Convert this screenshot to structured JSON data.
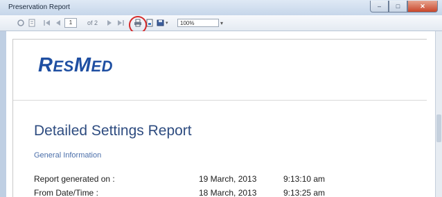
{
  "window": {
    "title": "Preservation Report",
    "buttons": {
      "minimize": "–",
      "maximize": "□",
      "close": "✕"
    }
  },
  "toolbar": {
    "page_current": "1",
    "page_of": "of 2",
    "zoom": "100%",
    "icons": [
      "refresh-icon",
      "print-layout-icon",
      "first-page-icon",
      "previous-page-icon",
      "next-page-icon",
      "last-page-icon",
      "print-icon",
      "page-setup-icon",
      "export-icon"
    ]
  },
  "report": {
    "logo_first": "R",
    "logo_rest": "ES",
    "logo_med_first": "M",
    "logo_med_rest": "ED",
    "title": "Detailed Settings Report",
    "section": "General Information",
    "rows": [
      {
        "label": "Report generated on :",
        "date": "19 March, 2013",
        "time": "9:13:10 am"
      },
      {
        "label": "From Date/Time :",
        "date": "18 March, 2013",
        "time": "9:13:25 am"
      }
    ]
  },
  "accent_colors": {
    "logo": "#1f4fa2",
    "title": "#2e4c80",
    "highlight_circle": "#d52a2a"
  }
}
